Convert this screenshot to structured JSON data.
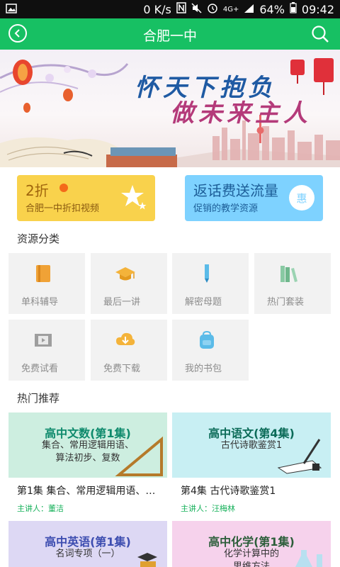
{
  "status_bar": {
    "net_speed": "0 K/s",
    "network_type": "4G+",
    "battery": "64%",
    "time": "09:42"
  },
  "app_bar": {
    "title": "合肥一中"
  },
  "banner": {
    "line1": "怀天下抱负",
    "line2": "做未来主人"
  },
  "promos": [
    {
      "title": "2折",
      "subtitle": "合肥一中折扣视频",
      "bg": "#f9d24c"
    },
    {
      "title": "返话费送流量",
      "subtitle": "促销的教学资源",
      "badge": "惠",
      "bg": "#7ed2ff"
    }
  ],
  "categories_title": "资源分类",
  "categories": [
    {
      "label": "单科辅导",
      "icon": "book-icon"
    },
    {
      "label": "最后一讲",
      "icon": "graduation-cap-icon"
    },
    {
      "label": "解密母题",
      "icon": "pencil-icon"
    },
    {
      "label": "热门套装",
      "icon": "books-icon"
    },
    {
      "label": "免费试看",
      "icon": "film-icon"
    },
    {
      "label": "免费下载",
      "icon": "cloud-download-icon"
    },
    {
      "label": "我的书包",
      "icon": "backpack-icon"
    }
  ],
  "hot_title": "热门推荐",
  "courses": [
    {
      "img_title": "高中文数(第1集)",
      "img_sub": [
        "集合、常用逻辑用语、",
        "算法初步、复数"
      ],
      "title": "第1集 集合、常用逻辑用语、…",
      "lecturer": "主讲人：董洁"
    },
    {
      "img_title": "高中语文(第4集)",
      "img_sub": [
        "古代诗歌鉴赏1"
      ],
      "title": "第4集 古代诗歌鉴赏1",
      "lecturer": "主讲人：汪梅林"
    },
    {
      "img_title": "高中英语(第1集)",
      "img_sub": [
        "名词专项（一）"
      ]
    },
    {
      "img_title": "高中化学(第1集)",
      "img_sub": [
        "化学计算中的",
        "思维方法"
      ]
    }
  ]
}
